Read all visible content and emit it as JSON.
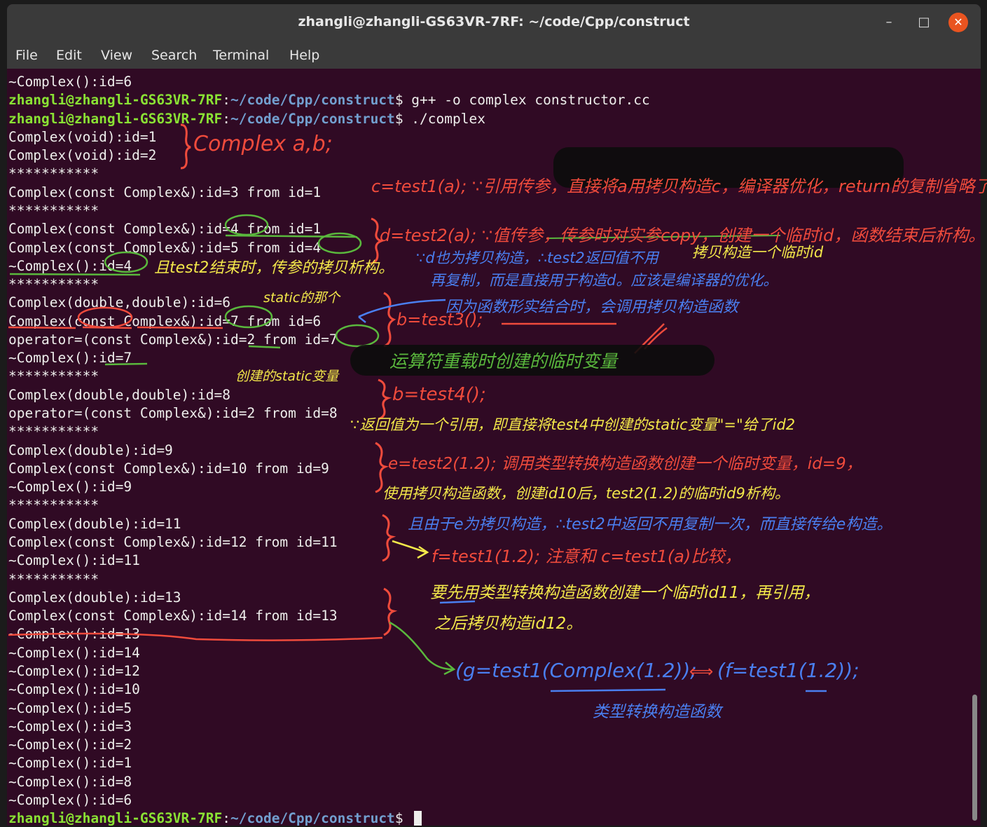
{
  "window": {
    "title": "zhangli@zhangli-GS63VR-7RF: ~/code/Cpp/construct",
    "min_glyph": "–",
    "max_glyph": "□",
    "close_glyph": "✕"
  },
  "menu": [
    "File",
    "Edit",
    "View",
    "Search",
    "Terminal",
    "Help"
  ],
  "prompt": {
    "user": "zhangli@zhangli-GS63VR-7RF",
    "path": "~/code/Cpp/construct",
    "symbol": "$"
  },
  "terminal_lines": [
    {
      "type": "out",
      "text": "~Complex():id=6"
    },
    {
      "type": "prompt",
      "cmd": " g++ -o complex constructor.cc"
    },
    {
      "type": "prompt",
      "cmd": " ./complex"
    },
    {
      "type": "out",
      "text": "Complex(void):id=1"
    },
    {
      "type": "out",
      "text": "Complex(void):id=2"
    },
    {
      "type": "out",
      "text": "***********"
    },
    {
      "type": "out",
      "text": "Complex(const Complex&):id=3 from id=1"
    },
    {
      "type": "out",
      "text": "***********"
    },
    {
      "type": "out",
      "text": "Complex(const Complex&):id=4 from id=1"
    },
    {
      "type": "out",
      "text": "Complex(const Complex&):id=5 from id=4"
    },
    {
      "type": "out",
      "text": "~Complex():id=4"
    },
    {
      "type": "out",
      "text": "***********"
    },
    {
      "type": "out",
      "text": "Complex(double,double):id=6"
    },
    {
      "type": "out",
      "text": "Complex(const Complex&):id=7 from id=6"
    },
    {
      "type": "out",
      "text": "operator=(const Complex&):id=2 from id=7"
    },
    {
      "type": "out",
      "text": "~Complex():id=7"
    },
    {
      "type": "out",
      "text": "***********"
    },
    {
      "type": "out",
      "text": "Complex(double,double):id=8"
    },
    {
      "type": "out",
      "text": "operator=(const Complex&):id=2 from id=8"
    },
    {
      "type": "out",
      "text": "***********"
    },
    {
      "type": "out",
      "text": "Complex(double):id=9"
    },
    {
      "type": "out",
      "text": "Complex(const Complex&):id=10 from id=9"
    },
    {
      "type": "out",
      "text": "~Complex():id=9"
    },
    {
      "type": "out",
      "text": "***********"
    },
    {
      "type": "out",
      "text": "Complex(double):id=11"
    },
    {
      "type": "out",
      "text": "Complex(const Complex&):id=12 from id=11"
    },
    {
      "type": "out",
      "text": "~Complex():id=11"
    },
    {
      "type": "out",
      "text": "***********"
    },
    {
      "type": "out",
      "text": "Complex(double):id=13"
    },
    {
      "type": "out",
      "text": "Complex(const Complex&):id=14 from id=13"
    },
    {
      "type": "out",
      "text": "~Complex():id=13"
    },
    {
      "type": "out",
      "text": "~Complex():id=14"
    },
    {
      "type": "out",
      "text": "~Complex():id=12"
    },
    {
      "type": "out",
      "text": "~Complex():id=10"
    },
    {
      "type": "out",
      "text": "~Complex():id=5"
    },
    {
      "type": "out",
      "text": "~Complex():id=3"
    },
    {
      "type": "out",
      "text": "~Complex():id=2"
    },
    {
      "type": "out",
      "text": "~Complex():id=1"
    },
    {
      "type": "out",
      "text": "~Complex():id=8"
    },
    {
      "type": "out",
      "text": "~Complex():id=6"
    },
    {
      "type": "prompt",
      "cmd": " ",
      "cursor": true
    }
  ],
  "annotations": {
    "complex_ab": "Complex a,b;",
    "test1_a": "c=test1(a); ∵引用传参，直接将a用拷贝构造c，编译器优化，return的复制省略了。",
    "test2_a": "d=test2(a); ∵值传参，传参时对实参copy，创建一个临时id，函数结束后析构。",
    "temp_copy": "拷贝构造一个临时id",
    "d_copy": "∵d也为拷贝构造，∴test2返回值不用",
    "d_copy2": "再复制，而是直接用于构造d。应该是编译器的优化。",
    "test2_end": "且test2结束时，传参的拷贝析构。",
    "static_one": "static的那个",
    "test3": "b=test3();",
    "test3_note": "因为函数形实结合时，会调用拷贝构造函数",
    "operator_temp": "运算符重载时创建的临时变量",
    "created_static": "创建的static变量",
    "test4": "b=test4();",
    "test4_note": "∵返回值为一个引用，即直接将test4中创建的static变量\"=\"给了id2",
    "e_test2": "e=test2(1.2); 调用类型转换构造函数创建一个临时变量，id=9，",
    "e_test2_b": "使用拷贝构造函数，创建id10后，test2(1.2)的临时id9析构。",
    "e_note": "且由于e为拷贝构造，∴test2中返回不用复制一次，而直接传给e构造。",
    "f_test1": "f=test1(1.2); 注意和 c=test1(a)比较，",
    "f_note": "要先用类型转换构造函数创建一个临时id11，再引用，",
    "f_note2": "之后拷贝构造id12。",
    "g_test1": "(g=test1(Complex(1.2));",
    "equiv": "⟺",
    "f_test1b": "(f=test1(1.2));",
    "type_conv": "类型转换构造函数"
  }
}
